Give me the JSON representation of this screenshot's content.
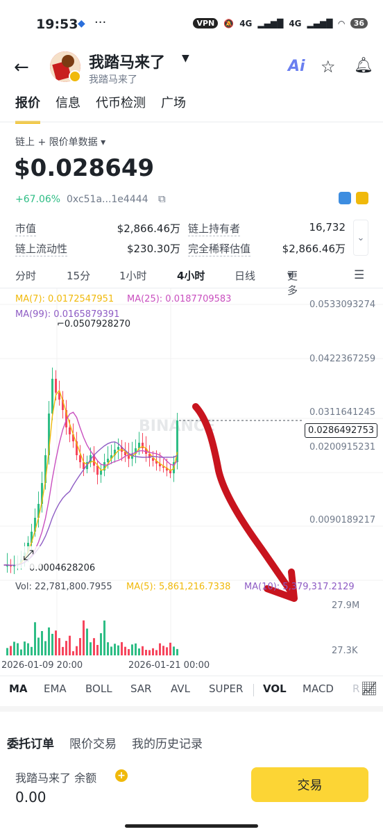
{
  "status_bar": {
    "time": "19:53",
    "vpn": "VPN",
    "net1": "4G",
    "net2": "4G",
    "battery": "36"
  },
  "header": {
    "title": "我踏马来了",
    "subtitle": "我踏马来了",
    "ai_label": "Ai"
  },
  "tabs": [
    "报价",
    "信息",
    "代币检测",
    "广场"
  ],
  "price_source": "链上 + 限价单数据",
  "price": "$0.028649",
  "change": "+67.06%",
  "contract": "0xc51a...1e4444",
  "stats": {
    "market_cap_label": "市值",
    "market_cap": "$2,866.46万",
    "holders_label": "链上持有者",
    "holders": "16,732",
    "liquidity_label": "链上流动性",
    "liquidity": "$230.30万",
    "fdv_label": "完全稀释估值",
    "fdv": "$2,866.46万"
  },
  "intervals": [
    "分时",
    "15分",
    "1小时",
    "4小时",
    "日线",
    "更多"
  ],
  "ma_legend": {
    "ma7": "MA(7): 0.0172547951",
    "ma25": "MA(25): 0.0187709583",
    "ma99": "MA(99): 0.0165879391"
  },
  "price_axis": [
    "0.0533093274",
    "0.0422367259",
    "0.0311641245",
    "0.0200915231",
    "0.0090189217"
  ],
  "high_marker": "0.0507928270",
  "low_marker": "0.0004628206",
  "current_price_tag": "0.0286492753",
  "watermark": "BINANCE",
  "volume": {
    "vol": "Vol: 22,781,800.7955",
    "ma5": "MA(5): 5,861,216.7338",
    "ma10": "MA(10): 5,379,317.2129",
    "axis_top": "27.9M",
    "axis_bottom": "27.3K"
  },
  "time_axis": [
    "2026-01-09 20:00",
    "2026-01-21 00:00"
  ],
  "indicators": [
    "MA",
    "EMA",
    "BOLL",
    "SAR",
    "AVL",
    "SUPER",
    "VOL",
    "MACD",
    "R"
  ],
  "bottom_tabs": [
    "委托订单",
    "限价交易",
    "我的历史记录"
  ],
  "balance_label": "我踏马来了 余额",
  "balance": "0.00",
  "trade_button": "交易",
  "colors": {
    "up": "#2ebd85",
    "down": "#f6465d",
    "ma7": "#f0b90b",
    "ma25": "#c94fbf",
    "ma99": "#8e5cc4",
    "accent": "#fcd535"
  }
}
